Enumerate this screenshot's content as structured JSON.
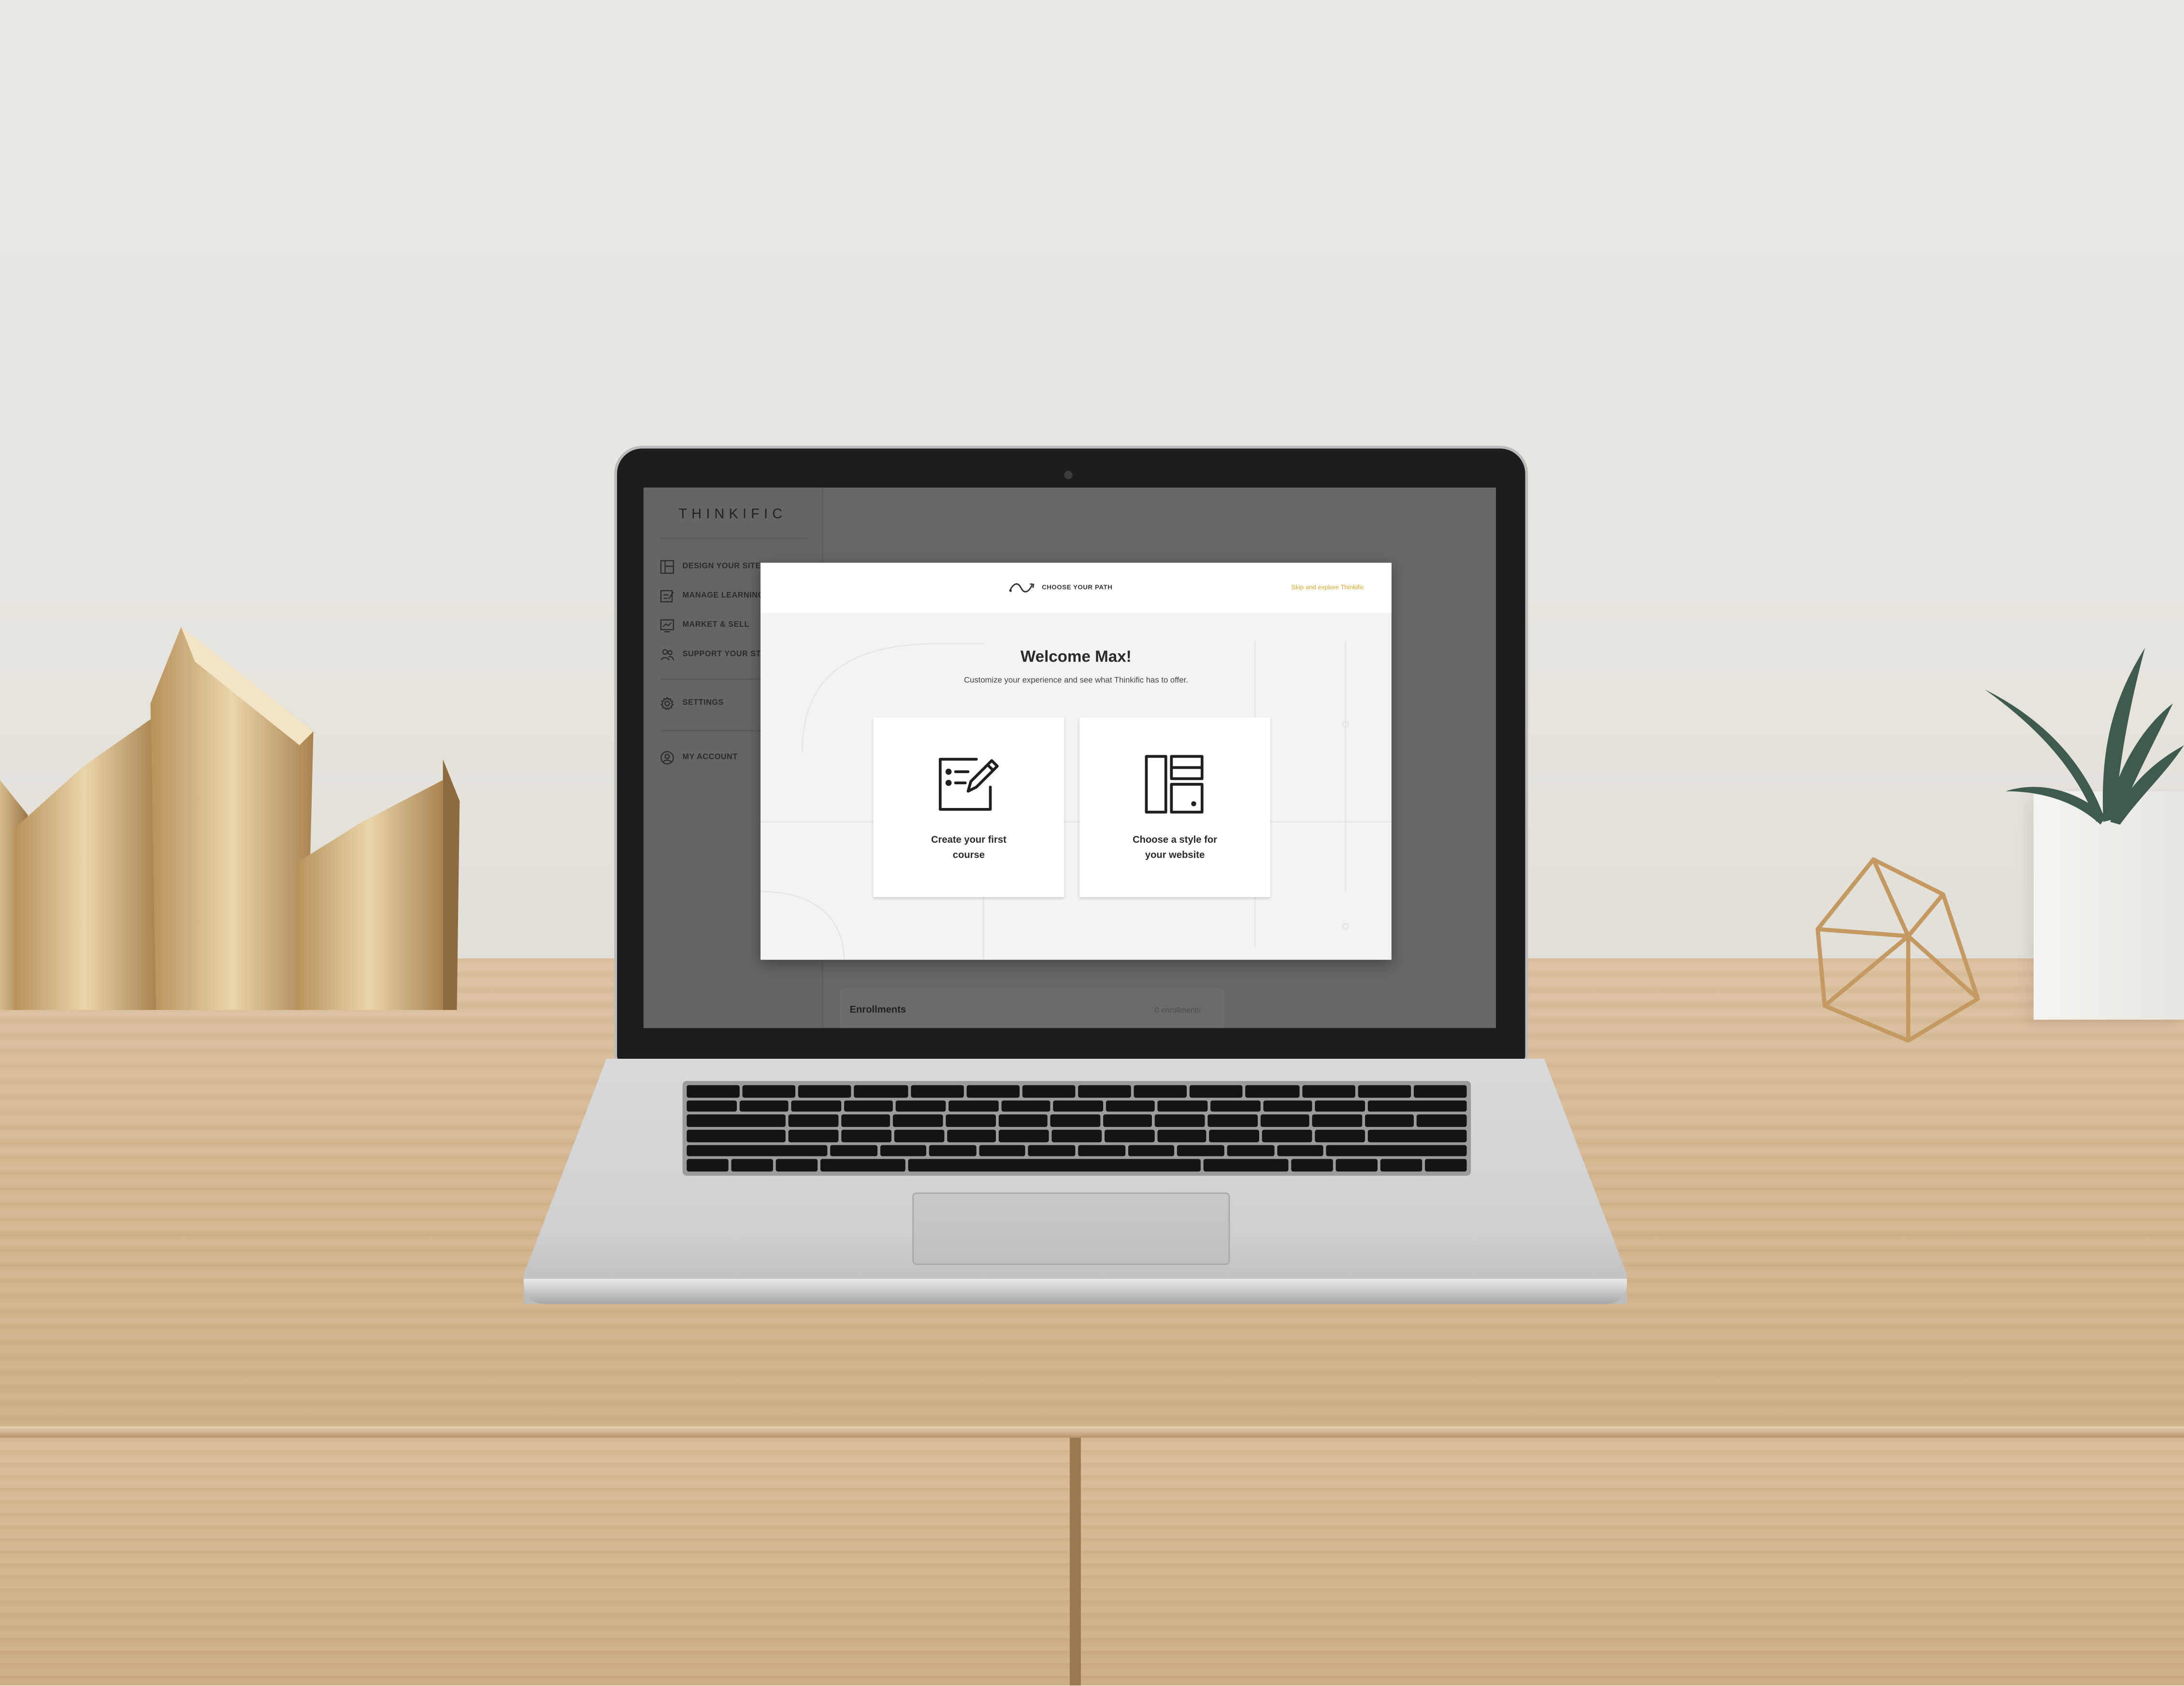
{
  "app": {
    "brand": "THINKIFIC",
    "sidebar": {
      "items": [
        {
          "label": "DESIGN YOUR SITE",
          "icon": "layout-icon"
        },
        {
          "label": "MANAGE LEARNING",
          "icon": "checklist-icon"
        },
        {
          "label": "MARKET & SELL",
          "icon": "chart-icon"
        },
        {
          "label": "SUPPORT YOUR STUDENTS",
          "icon": "users-icon"
        },
        {
          "label": "SETTINGS",
          "icon": "gear-icon"
        },
        {
          "label": "MY ACCOUNT",
          "icon": "user-circle-icon"
        }
      ]
    },
    "background_card": {
      "title": "Enrollments",
      "subtitle": "0 enrollments"
    }
  },
  "modal": {
    "header_label": "CHOOSE YOUR PATH",
    "skip_link": "Skip and explore Thinkific",
    "title": "Welcome Max!",
    "subtitle": "Customize your experience and see what Thinkific has to offer.",
    "cards": [
      {
        "label_line1": "Create your first",
        "label_line2": "course",
        "icon": "edit-course-icon"
      },
      {
        "label_line1": "Choose a style for",
        "label_line2": "your website",
        "icon": "layout-style-icon"
      }
    ]
  },
  "colors": {
    "accent": "#e2a62b",
    "overlay": "#676767",
    "modal_bg": "#f3f3f3"
  }
}
